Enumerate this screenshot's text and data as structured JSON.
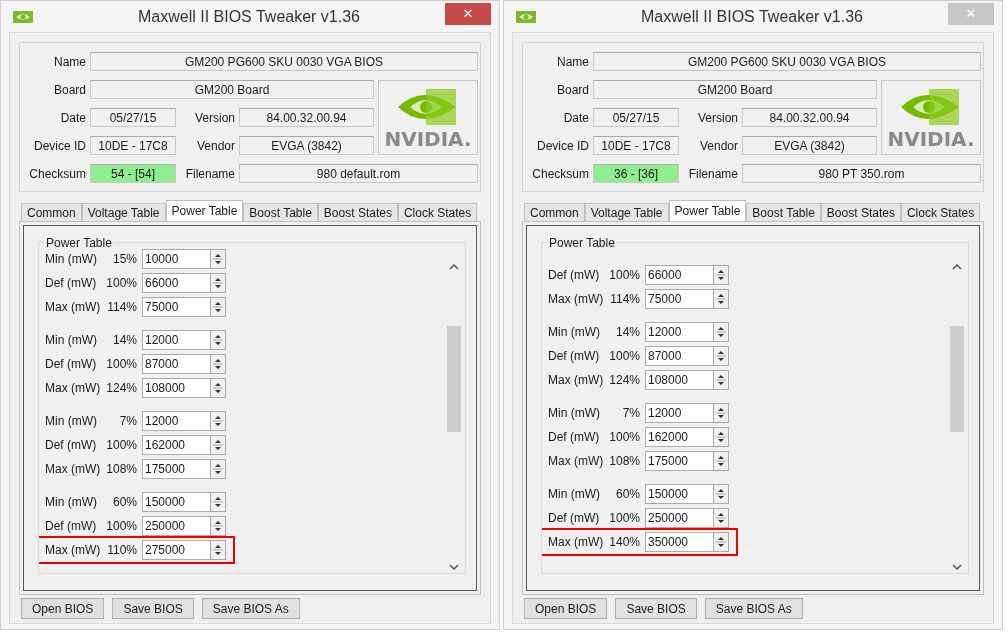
{
  "windows": [
    {
      "title": "Maxwell II BIOS Tweaker v1.36",
      "close": {
        "glyph": "✕",
        "active": true
      },
      "fields": [
        {
          "label": "Name",
          "value": "GM200 PG600 SKU 0030 VGA BIOS"
        },
        {
          "label": "Board",
          "value": "GM200 Board"
        },
        {
          "label": "Date",
          "value": "05/27/15"
        },
        {
          "label": "Version",
          "value": "84.00.32.00.94"
        },
        {
          "label": "Device ID",
          "value": "10DE - 17C8"
        },
        {
          "label": "Vendor",
          "value": "EVGA (3842)"
        },
        {
          "label": "Filename",
          "value": "980 default.rom"
        }
      ],
      "checksum": {
        "label": "Checksum",
        "value": "54 - [54]",
        "valid": true
      },
      "logo_text": "NVIDIA.",
      "tabs": [
        {
          "label": "Common",
          "selected": false
        },
        {
          "label": "Voltage Table",
          "selected": false
        },
        {
          "label": "Power Table",
          "selected": true
        },
        {
          "label": "Boost Table",
          "selected": false
        },
        {
          "label": "Boost States",
          "selected": false
        },
        {
          "label": "Clock States",
          "selected": false
        }
      ],
      "group": {
        "title": "Power Table",
        "sets": [
          {
            "rows": [
              {
                "label": "Min (mW)",
                "percent": "15%",
                "value": "10000",
                "highlighted": false
              },
              {
                "label": "Def (mW)",
                "percent": "100%",
                "value": "66000",
                "highlighted": false
              },
              {
                "label": "Max (mW)",
                "percent": "114%",
                "value": "75000",
                "highlighted": false
              }
            ]
          },
          {
            "rows": [
              {
                "label": "Min (mW)",
                "percent": "14%",
                "value": "12000",
                "highlighted": false
              },
              {
                "label": "Def (mW)",
                "percent": "100%",
                "value": "87000",
                "highlighted": false
              },
              {
                "label": "Max (mW)",
                "percent": "124%",
                "value": "108000",
                "highlighted": false
              }
            ]
          },
          {
            "rows": [
              {
                "label": "Min (mW)",
                "percent": "7%",
                "value": "12000",
                "highlighted": false
              },
              {
                "label": "Def (mW)",
                "percent": "100%",
                "value": "162000",
                "highlighted": false
              },
              {
                "label": "Max (mW)",
                "percent": "108%",
                "value": "175000",
                "highlighted": false
              }
            ]
          },
          {
            "rows": [
              {
                "label": "Min (mW)",
                "percent": "60%",
                "value": "150000",
                "highlighted": false
              },
              {
                "label": "Def (mW)",
                "percent": "100%",
                "value": "250000",
                "highlighted": false
              },
              {
                "label": "Max (mW)",
                "percent": "110%",
                "value": "275000",
                "highlighted": true
              }
            ]
          }
        ]
      },
      "buttons": [
        "Open BIOS",
        "Save BIOS",
        "Save BIOS As"
      ]
    },
    {
      "title": "Maxwell II BIOS Tweaker v1.36",
      "close": {
        "glyph": "✕",
        "active": false
      },
      "fields": [
        {
          "label": "Name",
          "value": "GM200 PG600 SKU 0030 VGA BIOS"
        },
        {
          "label": "Board",
          "value": "GM200 Board"
        },
        {
          "label": "Date",
          "value": "05/27/15"
        },
        {
          "label": "Version",
          "value": "84.00.32.00.94"
        },
        {
          "label": "Device ID",
          "value": "10DE - 17C8"
        },
        {
          "label": "Vendor",
          "value": "EVGA (3842)"
        },
        {
          "label": "Filename",
          "value": "980 PT 350.rom"
        }
      ],
      "checksum": {
        "label": "Checksum",
        "value": "36 - [36]",
        "valid": true
      },
      "logo_text": "NVIDIA.",
      "tabs": [
        {
          "label": "Common",
          "selected": false
        },
        {
          "label": "Voltage Table",
          "selected": false
        },
        {
          "label": "Power Table",
          "selected": true
        },
        {
          "label": "Boost Table",
          "selected": false
        },
        {
          "label": "Boost States",
          "selected": false
        },
        {
          "label": "Clock States",
          "selected": false
        }
      ],
      "group": {
        "title": "Power Table",
        "sets": [
          {
            "rows": [
              {
                "label": "Def (mW)",
                "percent": "100%",
                "value": "66000",
                "highlighted": false
              },
              {
                "label": "Max (mW)",
                "percent": "114%",
                "value": "75000",
                "highlighted": false
              }
            ]
          },
          {
            "rows": [
              {
                "label": "Min (mW)",
                "percent": "14%",
                "value": "12000",
                "highlighted": false
              },
              {
                "label": "Def (mW)",
                "percent": "100%",
                "value": "87000",
                "highlighted": false
              },
              {
                "label": "Max (mW)",
                "percent": "124%",
                "value": "108000",
                "highlighted": false
              }
            ]
          },
          {
            "rows": [
              {
                "label": "Min (mW)",
                "percent": "7%",
                "value": "12000",
                "highlighted": false
              },
              {
                "label": "Def (mW)",
                "percent": "100%",
                "value": "162000",
                "highlighted": false
              },
              {
                "label": "Max (mW)",
                "percent": "108%",
                "value": "175000",
                "highlighted": false
              }
            ]
          },
          {
            "rows": [
              {
                "label": "Min (mW)",
                "percent": "60%",
                "value": "150000",
                "highlighted": false
              },
              {
                "label": "Def (mW)",
                "percent": "100%",
                "value": "250000",
                "highlighted": false
              },
              {
                "label": "Max (mW)",
                "percent": "140%",
                "value": "350000",
                "highlighted": true
              }
            ]
          }
        ]
      },
      "buttons": [
        "Open BIOS",
        "Save BIOS",
        "Save BIOS As"
      ]
    }
  ]
}
